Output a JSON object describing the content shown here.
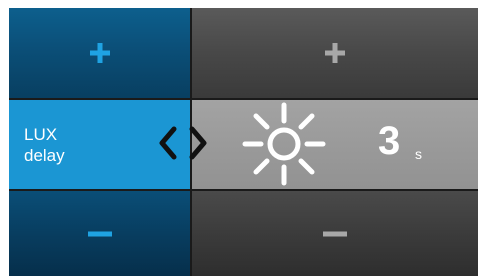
{
  "setting": {
    "label_line1": "LUX",
    "label_line2": "delay",
    "value": "3",
    "unit": "s"
  },
  "icons": {
    "increase": "plus-icon",
    "decrease": "minus-icon",
    "prev": "chevron-left-icon",
    "next": "chevron-right-icon",
    "setting": "sun-icon"
  },
  "colors": {
    "selected_bg": "#1b96d3",
    "blue_button": "#0b4f78",
    "grey_button": "#484848",
    "value_bg": "#9a9a9a"
  }
}
